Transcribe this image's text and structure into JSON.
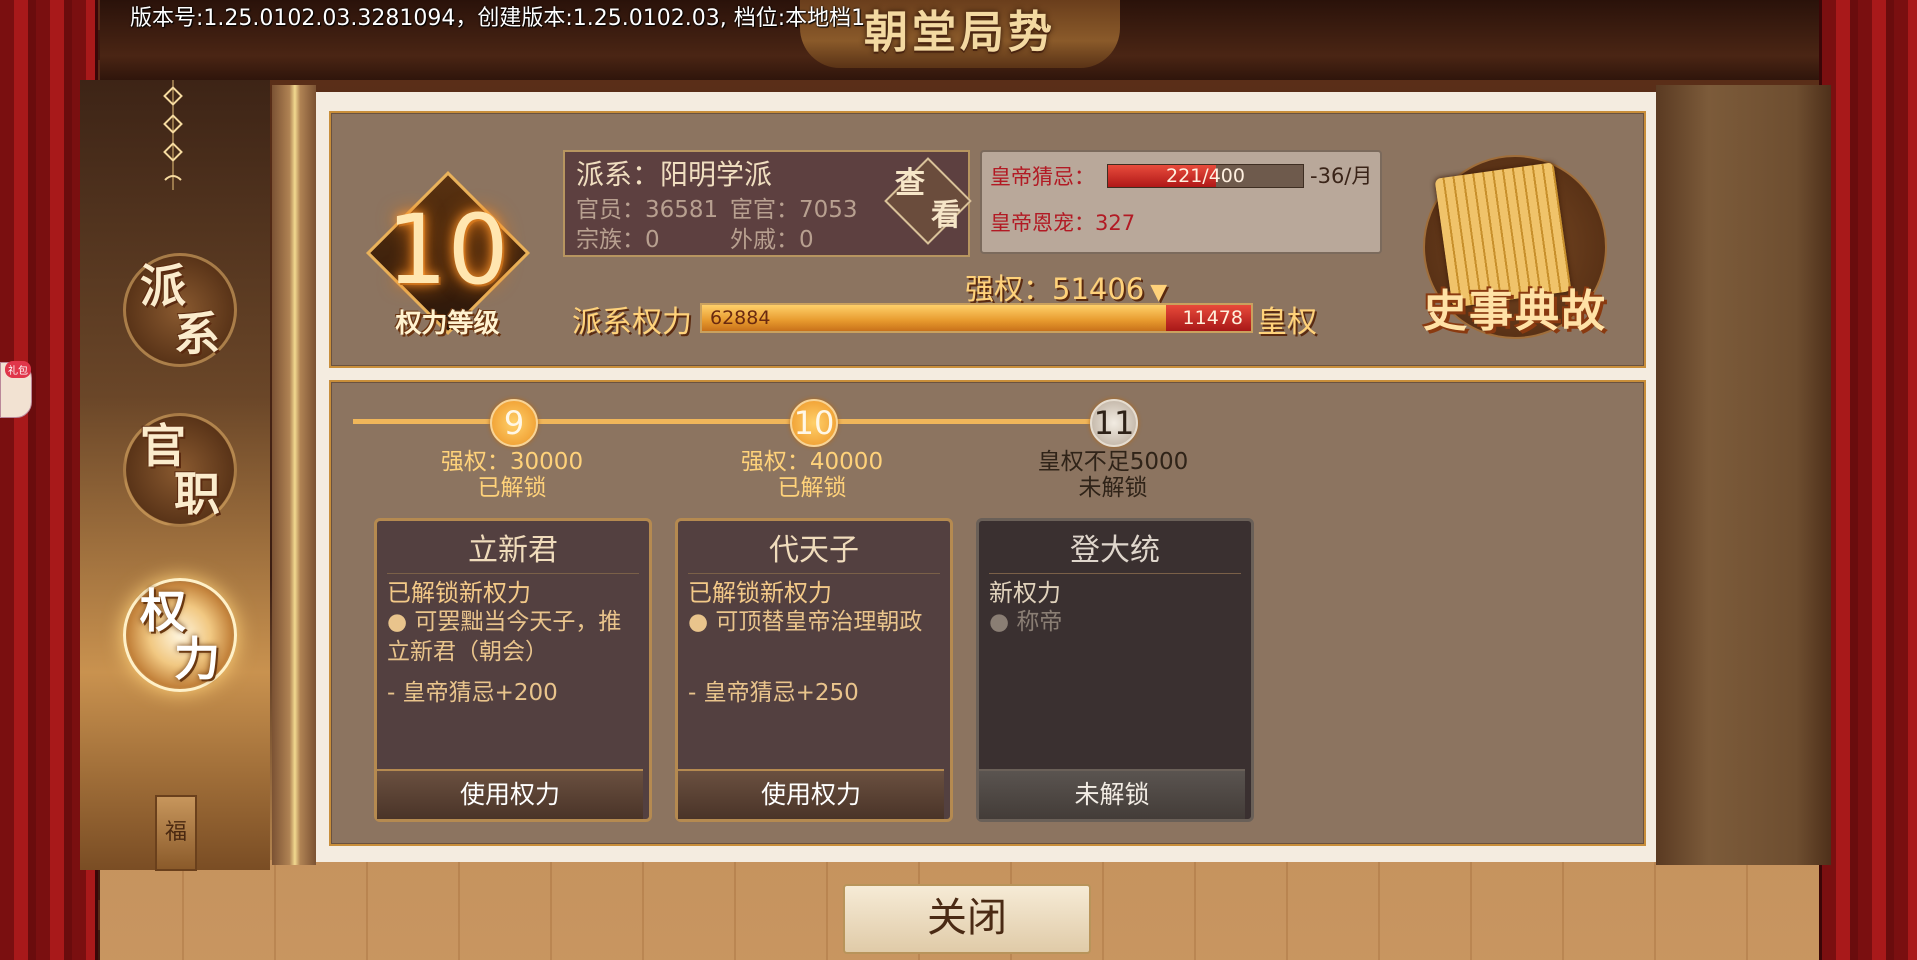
{
  "version_text": "版本号:1.25.0102.03.3281094，创建版本:1.25.0102.03, 档位:本地档1",
  "title": "朝堂局势",
  "side_tabs": [
    {
      "label_top": "派",
      "label_bottom": "系"
    },
    {
      "label_top": "官",
      "label_bottom": "职"
    },
    {
      "label_top": "权",
      "label_bottom": "力"
    }
  ],
  "fu_char": "福",
  "gift_badge": "礼包",
  "level": {
    "value": "10",
    "label": "权力等级"
  },
  "faction": {
    "name": "派系：阳明学派",
    "officials": "官员：36581",
    "eunuchs": "宦官：7053",
    "clan": "宗族：0",
    "in_laws": "外戚：0",
    "look_label_1": "查",
    "look_label_2": "看"
  },
  "emperor": {
    "suspicion_label": "皇帝猜忌：",
    "suspicion_value": 221,
    "suspicion_max": 400,
    "suspicion_text": "221/400",
    "suspicion_rate": "-36/月",
    "favor_label": "皇帝恩宠：327"
  },
  "power": {
    "strong_label": "强权：51406",
    "strong_arrow": "▼",
    "faction_label": "派系权力",
    "faction_value": 62884,
    "faction_text": "62884",
    "imperial_value": 11478,
    "imperial_text": "11478",
    "imperial_label": "皇权"
  },
  "history_label": "史事典故",
  "milestones": [
    {
      "level": "9",
      "cond": "强权：30000",
      "status": "已解锁",
      "locked": false
    },
    {
      "level": "10",
      "cond": "强权：40000",
      "status": "已解锁",
      "locked": false
    },
    {
      "level": "11",
      "cond": "皇权不足5000",
      "status": "未解锁",
      "locked": true
    }
  ],
  "cards": [
    {
      "title": "立新君",
      "sub": "已解锁新权力",
      "bullet": "● 可罢黜当今天子，推立新君（朝会）",
      "cost": "-  皇帝猜忌+200",
      "button": "使用权力"
    },
    {
      "title": "代天子",
      "sub": "已解锁新权力",
      "bullet": "● 可顶替皇帝治理朝政",
      "cost": "-  皇帝猜忌+250",
      "button": "使用权力"
    },
    {
      "title": "登大统",
      "sub": "新权力",
      "bullet": "● 称帝",
      "cost": "",
      "button": "未解锁"
    }
  ],
  "close_label": "关闭"
}
